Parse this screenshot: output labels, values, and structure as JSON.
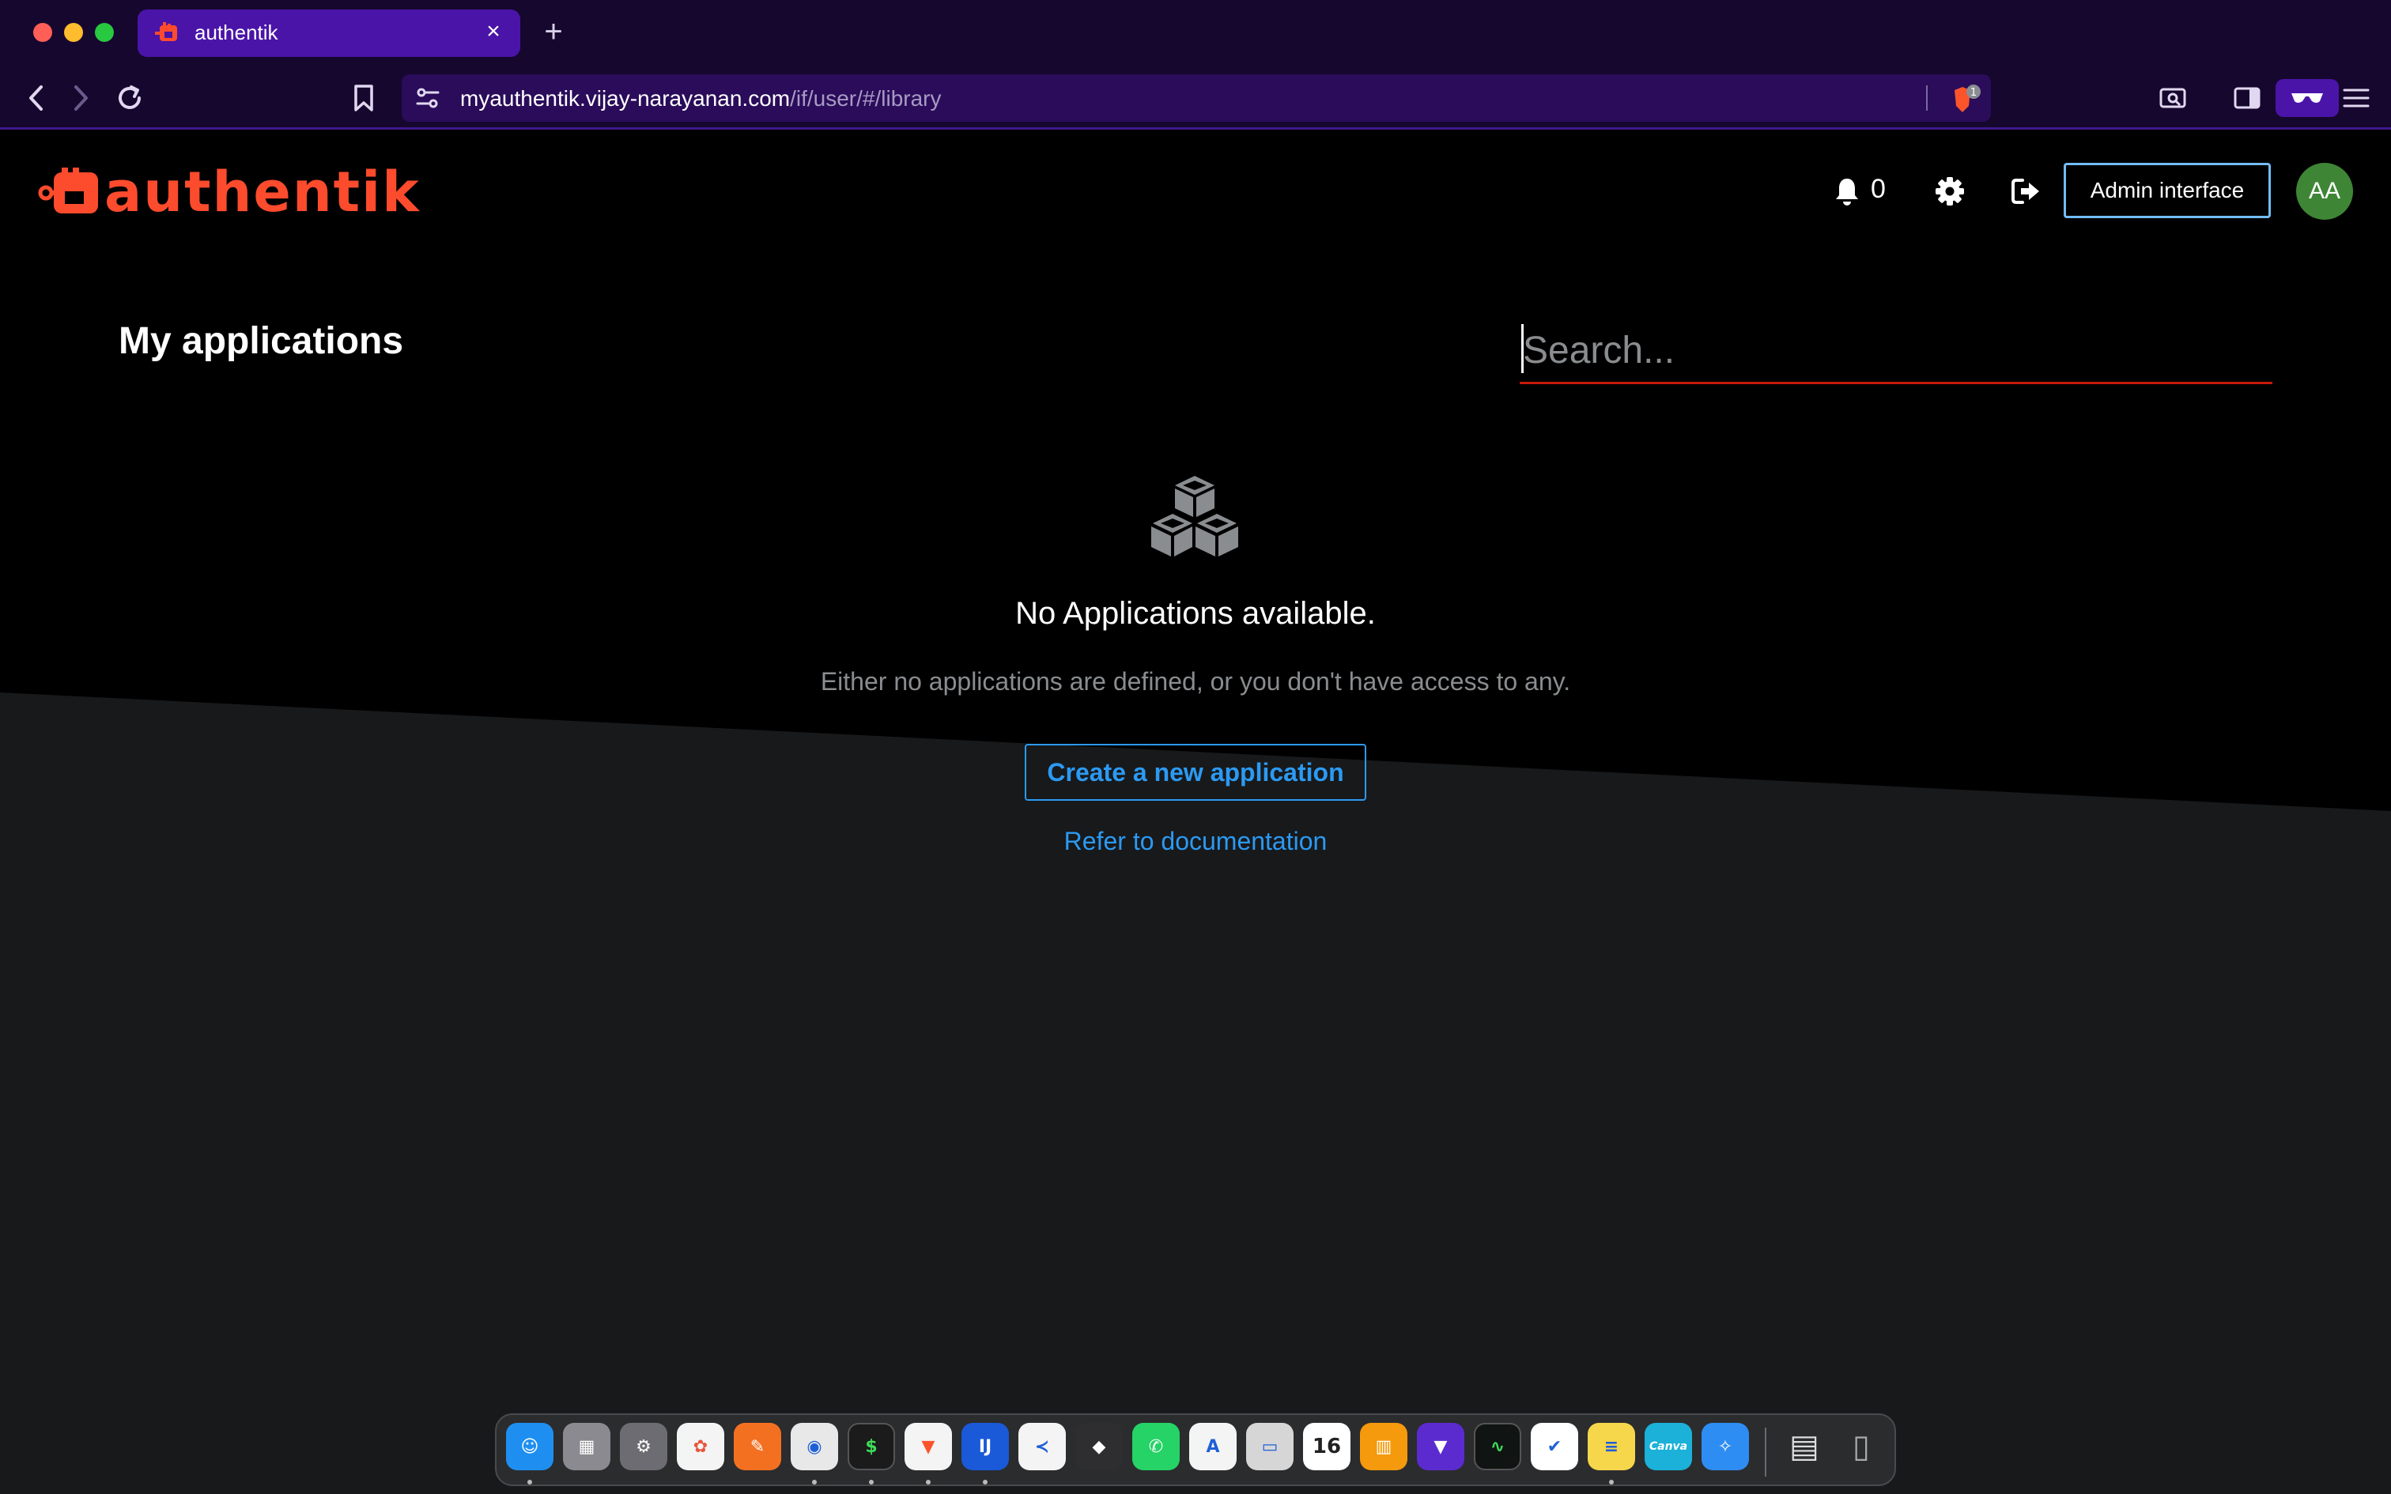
{
  "browser": {
    "tab_title": "authentik",
    "tab_close": "×",
    "new_tab": "+",
    "url_host": "myauthentik.vijay-narayanan.com",
    "url_path": "/if/user/#/library",
    "shield_count": "1",
    "accent": "#4a14a8"
  },
  "header": {
    "brand": "authentik",
    "brand_color": "#fd4b2d",
    "notification_count": "0",
    "admin_button": "Admin interface",
    "avatar_initials": "AA"
  },
  "main": {
    "title": "My applications",
    "search_placeholder": "Search...",
    "empty_title": "No Applications available.",
    "empty_body": "Either no applications are defined, or you don't have access to any.",
    "create_button": "Create a new application",
    "docs_link": "Refer to documentation"
  },
  "dock": {
    "apps": [
      {
        "name": "finder-icon",
        "color": "#1e8ff0",
        "glyph": "☺"
      },
      {
        "name": "launchpad-icon",
        "color": "#8a8a90",
        "glyph": "▦"
      },
      {
        "name": "system-settings-icon",
        "color": "#6c6c72",
        "glyph": "⚙"
      },
      {
        "name": "photos-icon",
        "color": "#f4f4f4",
        "glyph": "✿"
      },
      {
        "name": "pages-icon",
        "color": "#f37021",
        "glyph": "✎"
      },
      {
        "name": "chrome-icon",
        "color": "#e8e8e8",
        "glyph": "◉"
      },
      {
        "name": "terminal-icon",
        "color": "#1b1b1b",
        "glyph": "$"
      },
      {
        "name": "brave-icon",
        "color": "#f4f4f4",
        "glyph": "▼"
      },
      {
        "name": "intellij-icon",
        "color": "#1a59d8",
        "glyph": "IJ"
      },
      {
        "name": "vscode-icon",
        "color": "#f4f4f4",
        "glyph": "≺"
      },
      {
        "name": "obsidian-icon",
        "color": "#2e2e30",
        "glyph": "◆"
      },
      {
        "name": "whatsapp-icon",
        "color": "#25d366",
        "glyph": "✆"
      },
      {
        "name": "app-store-icon",
        "color": "#f4f4f4",
        "glyph": "A"
      },
      {
        "name": "preview-icon",
        "color": "#d6d6d6",
        "glyph": "▭"
      },
      {
        "name": "calendar-icon",
        "color": "#ffffff",
        "glyph": "16"
      },
      {
        "name": "books-icon",
        "color": "#f59a0c",
        "glyph": "▥"
      },
      {
        "name": "proton-vpn-icon",
        "color": "#5b2bd0",
        "glyph": "▼"
      },
      {
        "name": "activity-monitor-icon",
        "color": "#101412",
        "glyph": "∿"
      },
      {
        "name": "tasks-icon",
        "color": "#ffffff",
        "glyph": "✔"
      },
      {
        "name": "notes-icon",
        "color": "#f6d64a",
        "glyph": "≡"
      },
      {
        "name": "canva-icon",
        "color": "#1bb1d9",
        "glyph": "Canva"
      },
      {
        "name": "safari-icon",
        "color": "#2e8df2",
        "glyph": "✧"
      },
      {
        "name": "documents-folder-icon",
        "color": "#d9d9d9",
        "glyph": "▤"
      },
      {
        "name": "trash-icon",
        "color": "#3a3a3e",
        "glyph": "▯"
      }
    ]
  }
}
